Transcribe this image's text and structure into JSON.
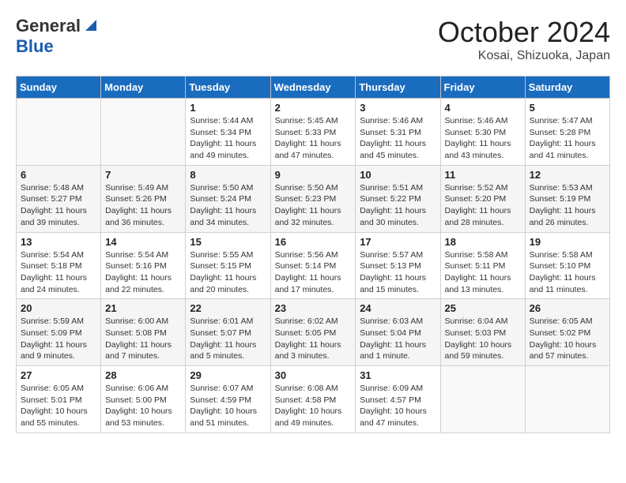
{
  "header": {
    "logo_general": "General",
    "logo_blue": "Blue",
    "title": "October 2024",
    "location": "Kosai, Shizuoka, Japan"
  },
  "days_of_week": [
    "Sunday",
    "Monday",
    "Tuesday",
    "Wednesday",
    "Thursday",
    "Friday",
    "Saturday"
  ],
  "weeks": [
    [
      {
        "day": "",
        "sunrise": "",
        "sunset": "",
        "daylight": ""
      },
      {
        "day": "",
        "sunrise": "",
        "sunset": "",
        "daylight": ""
      },
      {
        "day": "1",
        "sunrise": "Sunrise: 5:44 AM",
        "sunset": "Sunset: 5:34 PM",
        "daylight": "Daylight: 11 hours and 49 minutes."
      },
      {
        "day": "2",
        "sunrise": "Sunrise: 5:45 AM",
        "sunset": "Sunset: 5:33 PM",
        "daylight": "Daylight: 11 hours and 47 minutes."
      },
      {
        "day": "3",
        "sunrise": "Sunrise: 5:46 AM",
        "sunset": "Sunset: 5:31 PM",
        "daylight": "Daylight: 11 hours and 45 minutes."
      },
      {
        "day": "4",
        "sunrise": "Sunrise: 5:46 AM",
        "sunset": "Sunset: 5:30 PM",
        "daylight": "Daylight: 11 hours and 43 minutes."
      },
      {
        "day": "5",
        "sunrise": "Sunrise: 5:47 AM",
        "sunset": "Sunset: 5:28 PM",
        "daylight": "Daylight: 11 hours and 41 minutes."
      }
    ],
    [
      {
        "day": "6",
        "sunrise": "Sunrise: 5:48 AM",
        "sunset": "Sunset: 5:27 PM",
        "daylight": "Daylight: 11 hours and 39 minutes."
      },
      {
        "day": "7",
        "sunrise": "Sunrise: 5:49 AM",
        "sunset": "Sunset: 5:26 PM",
        "daylight": "Daylight: 11 hours and 36 minutes."
      },
      {
        "day": "8",
        "sunrise": "Sunrise: 5:50 AM",
        "sunset": "Sunset: 5:24 PM",
        "daylight": "Daylight: 11 hours and 34 minutes."
      },
      {
        "day": "9",
        "sunrise": "Sunrise: 5:50 AM",
        "sunset": "Sunset: 5:23 PM",
        "daylight": "Daylight: 11 hours and 32 minutes."
      },
      {
        "day": "10",
        "sunrise": "Sunrise: 5:51 AM",
        "sunset": "Sunset: 5:22 PM",
        "daylight": "Daylight: 11 hours and 30 minutes."
      },
      {
        "day": "11",
        "sunrise": "Sunrise: 5:52 AM",
        "sunset": "Sunset: 5:20 PM",
        "daylight": "Daylight: 11 hours and 28 minutes."
      },
      {
        "day": "12",
        "sunrise": "Sunrise: 5:53 AM",
        "sunset": "Sunset: 5:19 PM",
        "daylight": "Daylight: 11 hours and 26 minutes."
      }
    ],
    [
      {
        "day": "13",
        "sunrise": "Sunrise: 5:54 AM",
        "sunset": "Sunset: 5:18 PM",
        "daylight": "Daylight: 11 hours and 24 minutes."
      },
      {
        "day": "14",
        "sunrise": "Sunrise: 5:54 AM",
        "sunset": "Sunset: 5:16 PM",
        "daylight": "Daylight: 11 hours and 22 minutes."
      },
      {
        "day": "15",
        "sunrise": "Sunrise: 5:55 AM",
        "sunset": "Sunset: 5:15 PM",
        "daylight": "Daylight: 11 hours and 20 minutes."
      },
      {
        "day": "16",
        "sunrise": "Sunrise: 5:56 AM",
        "sunset": "Sunset: 5:14 PM",
        "daylight": "Daylight: 11 hours and 17 minutes."
      },
      {
        "day": "17",
        "sunrise": "Sunrise: 5:57 AM",
        "sunset": "Sunset: 5:13 PM",
        "daylight": "Daylight: 11 hours and 15 minutes."
      },
      {
        "day": "18",
        "sunrise": "Sunrise: 5:58 AM",
        "sunset": "Sunset: 5:11 PM",
        "daylight": "Daylight: 11 hours and 13 minutes."
      },
      {
        "day": "19",
        "sunrise": "Sunrise: 5:58 AM",
        "sunset": "Sunset: 5:10 PM",
        "daylight": "Daylight: 11 hours and 11 minutes."
      }
    ],
    [
      {
        "day": "20",
        "sunrise": "Sunrise: 5:59 AM",
        "sunset": "Sunset: 5:09 PM",
        "daylight": "Daylight: 11 hours and 9 minutes."
      },
      {
        "day": "21",
        "sunrise": "Sunrise: 6:00 AM",
        "sunset": "Sunset: 5:08 PM",
        "daylight": "Daylight: 11 hours and 7 minutes."
      },
      {
        "day": "22",
        "sunrise": "Sunrise: 6:01 AM",
        "sunset": "Sunset: 5:07 PM",
        "daylight": "Daylight: 11 hours and 5 minutes."
      },
      {
        "day": "23",
        "sunrise": "Sunrise: 6:02 AM",
        "sunset": "Sunset: 5:05 PM",
        "daylight": "Daylight: 11 hours and 3 minutes."
      },
      {
        "day": "24",
        "sunrise": "Sunrise: 6:03 AM",
        "sunset": "Sunset: 5:04 PM",
        "daylight": "Daylight: 11 hours and 1 minute."
      },
      {
        "day": "25",
        "sunrise": "Sunrise: 6:04 AM",
        "sunset": "Sunset: 5:03 PM",
        "daylight": "Daylight: 10 hours and 59 minutes."
      },
      {
        "day": "26",
        "sunrise": "Sunrise: 6:05 AM",
        "sunset": "Sunset: 5:02 PM",
        "daylight": "Daylight: 10 hours and 57 minutes."
      }
    ],
    [
      {
        "day": "27",
        "sunrise": "Sunrise: 6:05 AM",
        "sunset": "Sunset: 5:01 PM",
        "daylight": "Daylight: 10 hours and 55 minutes."
      },
      {
        "day": "28",
        "sunrise": "Sunrise: 6:06 AM",
        "sunset": "Sunset: 5:00 PM",
        "daylight": "Daylight: 10 hours and 53 minutes."
      },
      {
        "day": "29",
        "sunrise": "Sunrise: 6:07 AM",
        "sunset": "Sunset: 4:59 PM",
        "daylight": "Daylight: 10 hours and 51 minutes."
      },
      {
        "day": "30",
        "sunrise": "Sunrise: 6:08 AM",
        "sunset": "Sunset: 4:58 PM",
        "daylight": "Daylight: 10 hours and 49 minutes."
      },
      {
        "day": "31",
        "sunrise": "Sunrise: 6:09 AM",
        "sunset": "Sunset: 4:57 PM",
        "daylight": "Daylight: 10 hours and 47 minutes."
      },
      {
        "day": "",
        "sunrise": "",
        "sunset": "",
        "daylight": ""
      },
      {
        "day": "",
        "sunrise": "",
        "sunset": "",
        "daylight": ""
      }
    ]
  ]
}
